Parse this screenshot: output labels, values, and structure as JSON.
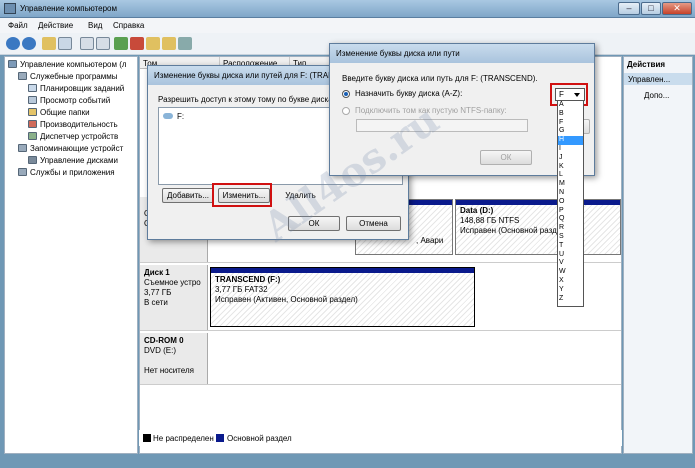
{
  "window": {
    "title": "Управление компьютером",
    "min": "–",
    "max": "□",
    "close": "✕"
  },
  "menu": [
    "Файл",
    "Действие",
    "Вид",
    "Справка"
  ],
  "tree": [
    "Управление компьютером (л",
    "Служебные программы",
    "Планировщик заданий",
    "Просмотр событий",
    "Общие папки",
    "Производительность",
    "Диспетчер устройств",
    "Запоминающие устройст",
    "Управление дисками",
    "Службы и приложения"
  ],
  "columns": [
    "Том",
    "Расположение",
    "Тип"
  ],
  "actions": {
    "header": "Действия",
    "item1": "Управлен...",
    "item2": "Допо..."
  },
  "disks": {
    "disk0": {
      "sys_frag": "О",
      "sys_frag2": "С",
      "part_b_frag": ", Авари",
      "data_name": "Data (D:)",
      "data_size": "148,88 ГБ NTFS",
      "data_status": "Исправен (Основной раздел"
    },
    "disk1": {
      "name": "Диск 1",
      "type": "Съемное устро",
      "size": "3,77 ГБ",
      "status": "В сети",
      "part_name": "TRANSCEND  (F:)",
      "part_size": "3,77 ГБ FAT32",
      "part_status": "Исправен (Активен, Основной раздел)"
    },
    "cdrom": {
      "name": "CD-ROM 0",
      "type": "DVD (E:)",
      "media": "Нет носителя"
    }
  },
  "legend": {
    "unallocated": "Не распределен",
    "primary": "Основной раздел"
  },
  "dialog1": {
    "title": "Изменение буквы диска или путей для F: (TRANSC",
    "text": "Разрешить доступ к этому тому по букве диска и",
    "entry": "F:",
    "add": "Добавить...",
    "change": "Изменить...",
    "remove": "Удалить",
    "ok": "ОК",
    "cancel": "Отмена"
  },
  "dialog2": {
    "title": "Изменение буквы диска или пути",
    "prompt": "Введите букву диска или путь для F: (TRANSCEND).",
    "assign": "Назначить букву диска (A-Z):",
    "mount": "Подключить том как пустую NTFS-папку:",
    "browse": "Об",
    "ok": "ОК",
    "selected": "F"
  },
  "letters": [
    "A",
    "B",
    "F",
    "G",
    "H",
    "I",
    "J",
    "K",
    "L",
    "M",
    "N",
    "O",
    "P",
    "Q",
    "R",
    "S",
    "T",
    "U",
    "V",
    "W",
    "X",
    "Y",
    "Z"
  ],
  "selected_letter_index": 4,
  "watermark": "All4os.ru"
}
